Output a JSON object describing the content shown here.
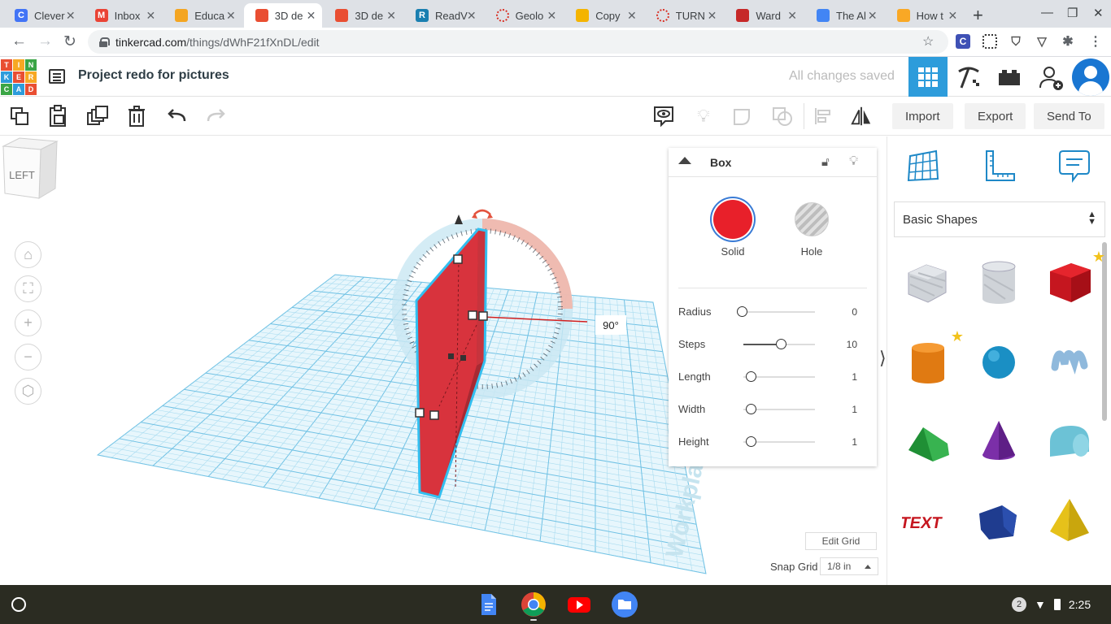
{
  "browser": {
    "tabs": [
      {
        "label": "Clever",
        "favicon": "clever-icon",
        "color": "#4274f6",
        "glyph": "C",
        "active": false
      },
      {
        "label": "Inbox",
        "favicon": "gmail-icon",
        "color": "#ea4335",
        "glyph": "M",
        "active": false
      },
      {
        "label": "Educa",
        "favicon": "shield-icon",
        "color": "#f4a521",
        "glyph": "",
        "active": false
      },
      {
        "label": "3D de",
        "favicon": "tinkercad-icon",
        "color": "#e94e32",
        "glyph": "",
        "active": true
      },
      {
        "label": "3D de",
        "favicon": "tinkercad-icon",
        "color": "#e94e32",
        "glyph": "",
        "active": false
      },
      {
        "label": "ReadV",
        "favicon": "readworks-icon",
        "color": "#1a7fb0",
        "glyph": "R",
        "active": false
      },
      {
        "label": "Geolo",
        "favicon": "loading-icon",
        "color": "#d93025",
        "glyph": "",
        "active": false
      },
      {
        "label": "Copy",
        "favicon": "slides-icon",
        "color": "#f4b400",
        "glyph": "",
        "active": false
      },
      {
        "label": "TURN",
        "favicon": "loading-icon",
        "color": "#d93025",
        "glyph": "",
        "active": false
      },
      {
        "label": "Ward",
        "favicon": "app-icon",
        "color": "#c62828",
        "glyph": "",
        "active": false
      },
      {
        "label": "The Al",
        "favicon": "docs-icon",
        "color": "#4285f4",
        "glyph": "",
        "active": false
      },
      {
        "label": "How t",
        "favicon": "face-icon",
        "color": "#f9a825",
        "glyph": "",
        "active": false
      }
    ],
    "url_host": "tinkercad.com",
    "url_path": "/things/dWhF21fXnDL/edit"
  },
  "app": {
    "logo_letters": [
      "TIN",
      "KER",
      "CAD"
    ],
    "project_title": "Project redo for pictures",
    "save_status": "All changes saved"
  },
  "toolbar": {
    "import_label": "Import",
    "export_label": "Export",
    "send_to_label": "Send To"
  },
  "viewport": {
    "viewcube_face": "LEFT",
    "rotation_angle": "90°",
    "workplane_label": "Workplane",
    "edit_grid_label": "Edit Grid",
    "snap_grid_label": "Snap Grid",
    "snap_grid_value": "1/8 in"
  },
  "inspector": {
    "shape_name": "Box",
    "solid_label": "Solid",
    "hole_label": "Hole",
    "solid_color": "#e8202a",
    "params": [
      {
        "name": "Radius",
        "value": "0",
        "fraction": 0.0
      },
      {
        "name": "Steps",
        "value": "10",
        "fraction": 0.45
      },
      {
        "name": "Length",
        "value": "1",
        "fraction": 0.0
      },
      {
        "name": "Width",
        "value": "1",
        "fraction": 0.0
      },
      {
        "name": "Height",
        "value": "1",
        "fraction": 0.0
      }
    ]
  },
  "shapes_panel": {
    "category": "Basic Shapes",
    "shapes": [
      {
        "name": "box-hole-shape",
        "starred": false
      },
      {
        "name": "cylinder-hole-shape",
        "starred": false
      },
      {
        "name": "box-shape",
        "starred": true
      },
      {
        "name": "cylinder-shape",
        "starred": true
      },
      {
        "name": "sphere-shape",
        "starred": false
      },
      {
        "name": "scribble-shape",
        "starred": false
      },
      {
        "name": "roof-shape",
        "starred": false
      },
      {
        "name": "cone-shape",
        "starred": false
      },
      {
        "name": "round-roof-shape",
        "starred": false
      },
      {
        "name": "text-shape",
        "starred": false
      },
      {
        "name": "polygon-shape",
        "starred": false
      },
      {
        "name": "pyramid-shape",
        "starred": false
      }
    ]
  },
  "shelf": {
    "notification_count": "2",
    "time": "2:25"
  }
}
